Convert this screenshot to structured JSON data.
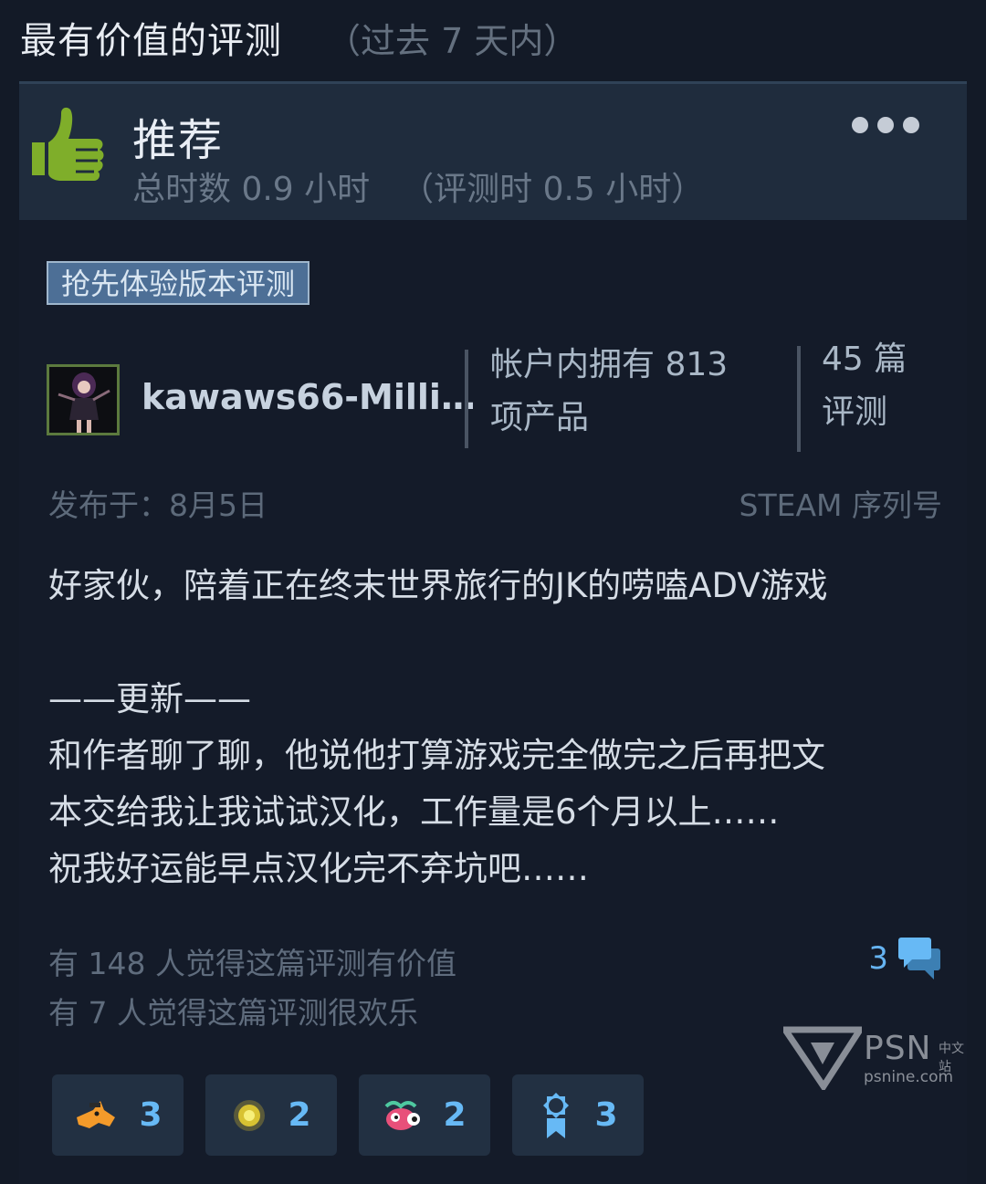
{
  "section": {
    "title": "最有价值的评测",
    "period": "（过去 7 天内）"
  },
  "header": {
    "verdict": "推荐",
    "total_hours": "总时数 0.9 小时",
    "review_hours": "（评测时 0.5 小时）",
    "thumb_icon": "thumbs-up-icon",
    "more_icon": "more-dots-icon"
  },
  "tag": "抢先体验版本评测",
  "author": {
    "name": "kawaws66-Milli…",
    "products_line1": "帐户内拥有 813",
    "products_line2": "项产品",
    "reviews_line1": "45 篇",
    "reviews_line2": "评测"
  },
  "meta": {
    "posted": "发布于：8月5日",
    "source": "STEAM 序列号"
  },
  "review": {
    "line1": "好家伙，陪着正在终末世界旅行的JK的唠嗑ADV游戏",
    "line2": "——更新——",
    "line3": "和作者聊了聊，他说他打算游戏完全做完之后再把文",
    "line4": "本交给我让我试试汉化，工作量是6个月以上……",
    "line5": "祝我好运能早点汉化完不弃坑吧……"
  },
  "votes": {
    "helpful": "有 148 人觉得这篇评测有价值",
    "funny": "有 7 人觉得这篇评测很欢乐",
    "comment_count": "3",
    "comment_icon": "comment-bubbles-icon"
  },
  "awards": [
    {
      "icon": "orange-dog-award-icon",
      "count": "3"
    },
    {
      "icon": "golden-coin-award-icon",
      "count": "2"
    },
    {
      "icon": "pink-creature-award-icon",
      "count": "2"
    },
    {
      "icon": "ribbon-medal-award-icon",
      "count": "3"
    }
  ],
  "watermark": {
    "brand": "PSN",
    "brand_cn": "中文站",
    "url": "psnine.com"
  },
  "colors": {
    "background": "#131a27",
    "header_bg": "#1f2c3d",
    "thumb_green": "#7fae2a",
    "tag_bg": "#4d6f96",
    "accent_blue": "#67b9f5"
  }
}
